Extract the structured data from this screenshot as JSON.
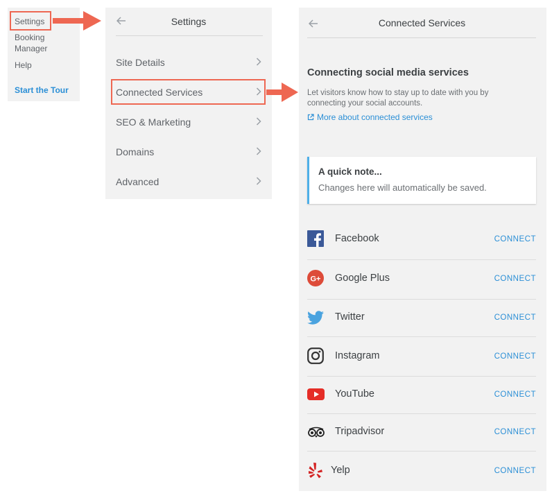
{
  "sidebar": {
    "items": [
      {
        "label": "Settings"
      },
      {
        "label": "Booking"
      },
      {
        "label": "Manager"
      },
      {
        "label": "Help"
      }
    ],
    "tour_link": "Start the Tour"
  },
  "settings_panel": {
    "title": "Settings",
    "menu": [
      {
        "label": "Site Details"
      },
      {
        "label": "Connected Services"
      },
      {
        "label": "SEO & Marketing"
      },
      {
        "label": "Domains"
      },
      {
        "label": "Advanced"
      }
    ]
  },
  "connected_panel": {
    "title": "Connected Services",
    "heading": "Connecting social media services",
    "description": "Let visitors know how to stay up to date with you by connecting your social accounts.",
    "more_link": "More about connected services",
    "note": {
      "title": "A quick note...",
      "text": "Changes here will automatically be saved."
    },
    "services": [
      {
        "name": "Facebook",
        "action": "CONNECT",
        "icon": "facebook-icon",
        "color": "#3b5998"
      },
      {
        "name": "Google Plus",
        "action": "CONNECT",
        "icon": "google-plus-icon",
        "color": "#dd4b39"
      },
      {
        "name": "Twitter",
        "action": "CONNECT",
        "icon": "twitter-icon",
        "color": "#4aa3df"
      },
      {
        "name": "Instagram",
        "action": "CONNECT",
        "icon": "instagram-icon",
        "color": "#333333"
      },
      {
        "name": "YouTube",
        "action": "CONNECT",
        "icon": "youtube-icon",
        "color": "#e52d27"
      },
      {
        "name": "Tripadvisor",
        "action": "CONNECT",
        "icon": "tripadvisor-icon",
        "color": "#222222"
      },
      {
        "name": "Yelp",
        "action": "CONNECT",
        "icon": "yelp-icon",
        "color": "#d32323"
      }
    ]
  },
  "colors": {
    "accent": "#2b8fd6",
    "highlight": "#ee6752",
    "panel_bg": "#f2f2f2",
    "note_border": "#4fb0e8"
  }
}
